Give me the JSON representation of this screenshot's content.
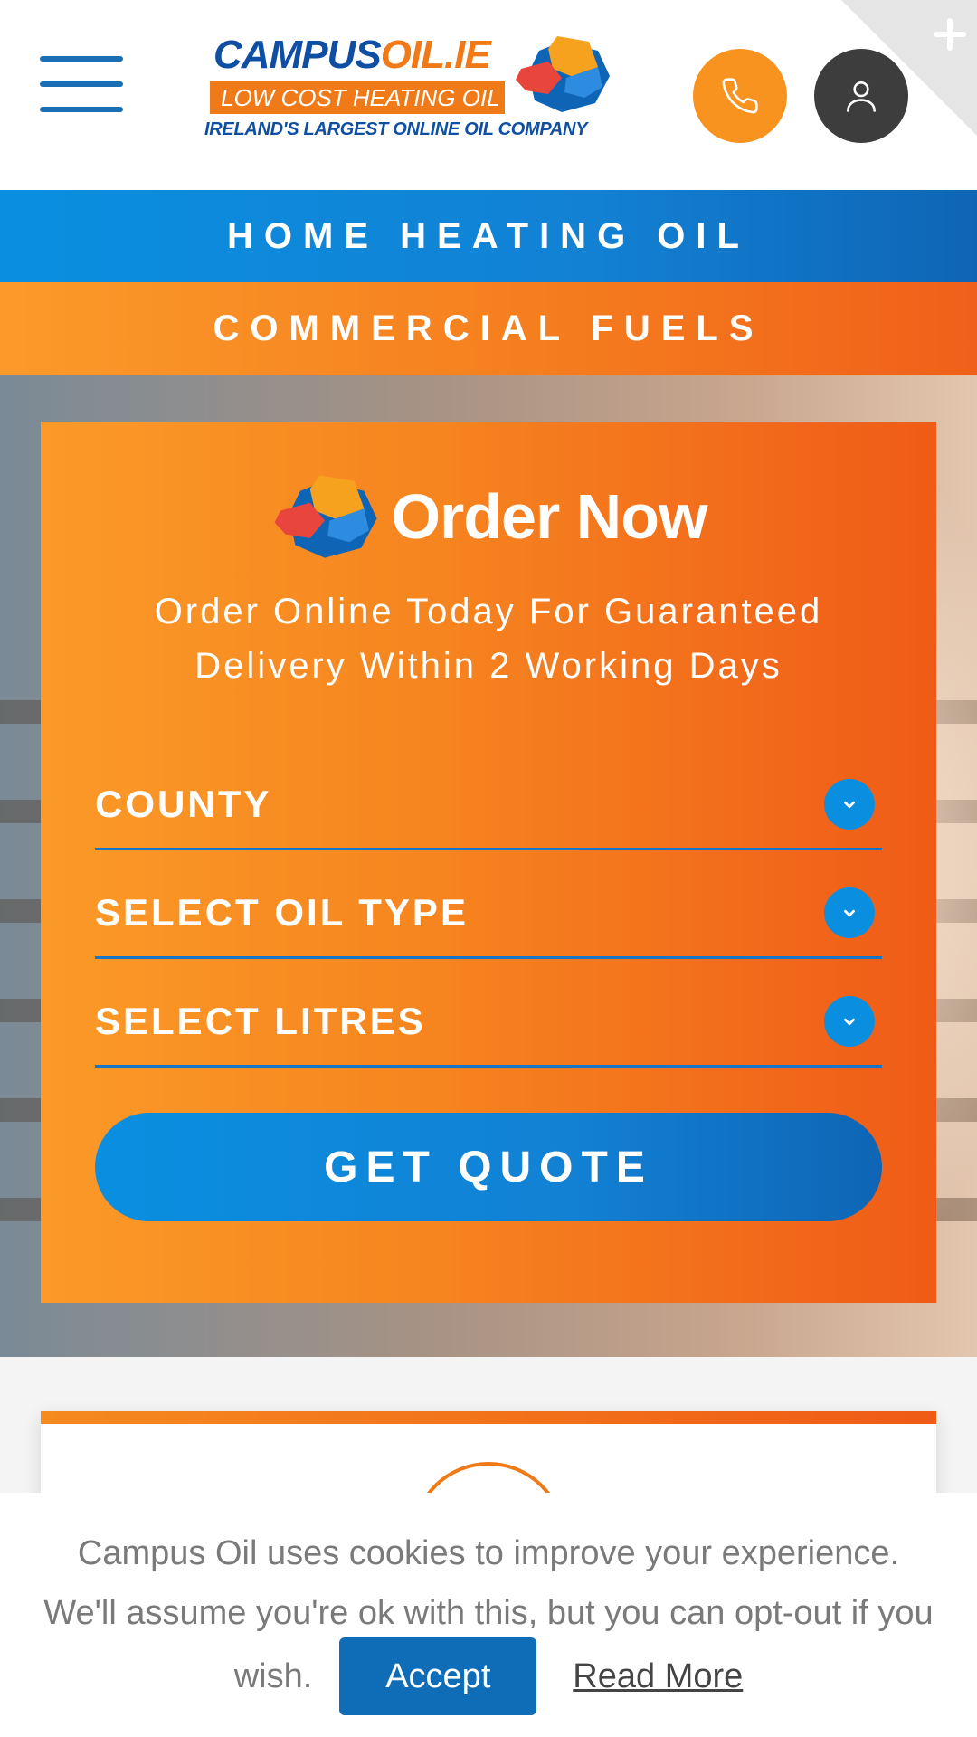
{
  "header": {
    "logo": {
      "word_main": "CAMPUS",
      "word_accent": "OIL.IE",
      "tagline": "LOW COST HEATING OIL",
      "subline": "IRELAND'S LARGEST ONLINE OIL COMPANY"
    },
    "menu_icon": "hamburger-icon",
    "phone_icon": "phone-icon",
    "user_icon": "user-icon",
    "corner_icon": "plus-icon"
  },
  "nav": {
    "home_heating": "HOME HEATING OIL",
    "commercial": "COMMERCIAL FUELS"
  },
  "order": {
    "title": "Order Now",
    "subtitle_line1": "Order Online Today For Guaranteed",
    "subtitle_line2": "Delivery Within 2 Working Days",
    "county": "COUNTY",
    "oil_type": "SELECT OIL TYPE",
    "litres": "SELECT LITRES",
    "quote_button": "GET QUOTE"
  },
  "cookie": {
    "line1": "Campus Oil uses cookies to improve your experience.",
    "line2": "We'll assume you're ok with this, but you can opt-out if you",
    "line3": "wish.",
    "accept": "Accept",
    "read_more": "Read More"
  },
  "colors": {
    "brand_blue": "#0f4fa3",
    "brand_orange": "#f07a18",
    "button_blue": "#0a8fe0",
    "dark": "#3d3d3d"
  }
}
